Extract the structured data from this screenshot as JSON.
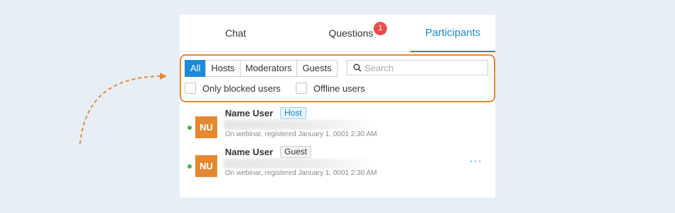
{
  "tabs": {
    "chat": "Chat",
    "questions": "Questions",
    "questions_badge": "1",
    "participants": "Participants"
  },
  "filters": {
    "all": "All",
    "hosts": "Hosts",
    "moderators": "Moderators",
    "guests": "Guests",
    "selected": "All"
  },
  "search": {
    "placeholder": "Search",
    "value": ""
  },
  "checkboxes": {
    "blocked": "Only blocked users",
    "offline": "Offline users"
  },
  "participants": [
    {
      "initials": "NU",
      "name": "Name User",
      "role": "Host",
      "status": "On webinar,",
      "registered": "registered January 1, 0001 2:30 AM"
    },
    {
      "initials": "NU",
      "name": "Name User",
      "role": "Guest",
      "status": "On webinar,",
      "registered": "registered January 1, 0001 2:30 AM",
      "more": "···"
    }
  ],
  "colors": {
    "accent": "#1a8bdb",
    "highlight": "#e08a3a",
    "avatar": "#e4892f",
    "online": "#46b545",
    "badge": "#ea4b4b"
  },
  "icons": [
    "search-icon",
    "more-options-icon",
    "dashed-arrow"
  ]
}
